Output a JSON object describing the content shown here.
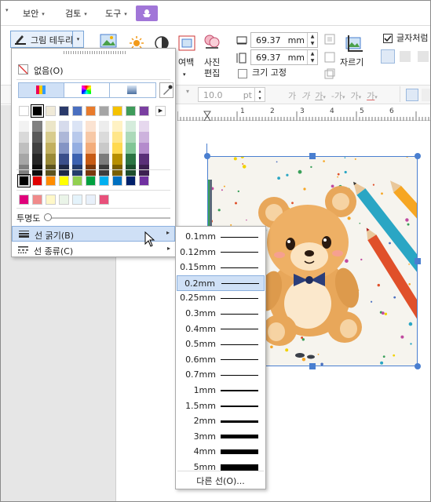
{
  "menubar": {
    "items": [
      {
        "label": "보안"
      },
      {
        "label": "검토"
      },
      {
        "label": "도구"
      }
    ]
  },
  "ribbon": {
    "border_button_label": "그림 테두리",
    "margin_label": "여백",
    "photo_edit_label_1": "사진",
    "photo_edit_label_2": "편집",
    "width_value": "69.37",
    "height_value": "69.37",
    "unit": "mm",
    "fix_size_label": "크기 고정",
    "crop_label": "자르기",
    "wrap_label": "글자처럼"
  },
  "fontrow": {
    "size_value": "10.0",
    "size_unit": "pt"
  },
  "ruler": {
    "numbers": [
      "1",
      "2",
      "3",
      "4",
      "5",
      "6"
    ]
  },
  "border_panel": {
    "none_label": "없음(O)",
    "transparency_label": "투명도",
    "line_width_label": "선 굵기(B)",
    "line_type_label": "선 종류(C)",
    "palette_top_row": [
      "#ffffff",
      "#000000",
      "#f0ead8",
      "#2a3a6a",
      "#4a6fc0",
      "#e87b2c",
      "#a5a5a5",
      "#f5c200",
      "#3e9b5a",
      "#7a3fa0"
    ],
    "palette_columns": [
      [
        "#f2f2f2",
        "#d9d9d9",
        "#bfbfbf",
        "#a6a6a6",
        "#7f7f7f"
      ],
      [
        "#808080",
        "#595959",
        "#404040",
        "#262626",
        "#0d0d0d"
      ],
      [
        "#ece6c8",
        "#d8cc8e",
        "#c2b060",
        "#9a8a38",
        "#5c531f"
      ],
      [
        "#d6dbec",
        "#adb7d8",
        "#8494c4",
        "#3a4e8a",
        "#1e2846"
      ],
      [
        "#dbe4f5",
        "#b8c9eb",
        "#94aee1",
        "#3c62b0",
        "#243c6b"
      ],
      [
        "#fbe3d2",
        "#f7c8a6",
        "#f3ac7a",
        "#c75b15",
        "#7a380c"
      ],
      [
        "#ededed",
        "#dbdbdb",
        "#c9c9c9",
        "#7c7c7c",
        "#3d3d3d"
      ],
      [
        "#fff2c4",
        "#ffe68a",
        "#ffd94f",
        "#b78f00",
        "#7a5f00"
      ],
      [
        "#d5ecdc",
        "#acd9b9",
        "#82c696",
        "#2c7443",
        "#1d4d2c"
      ],
      [
        "#e6d8ee",
        "#cdb2dd",
        "#b48bcc",
        "#5a2f78",
        "#3c1f50"
      ]
    ],
    "palette_standard": [
      "#000000",
      "#e00000",
      "#ff8c00",
      "#ffff00",
      "#92d050",
      "#00a040",
      "#00b0f0",
      "#0070c0",
      "#00206a",
      "#7030a0"
    ],
    "palette_recent": [
      "#e0007a",
      "#f08a8a",
      "#fff8c8",
      "#eaf4e8",
      "#e4f3fb",
      "#e8f0fa",
      "#e8507a"
    ]
  },
  "line_width_menu": {
    "items": [
      {
        "label": "0.1mm",
        "weight": 0.1
      },
      {
        "label": "0.12mm",
        "weight": 0.12
      },
      {
        "label": "0.15mm",
        "weight": 0.15
      },
      {
        "label": "0.2mm",
        "weight": 0.2
      },
      {
        "label": "0.25mm",
        "weight": 0.25
      },
      {
        "label": "0.3mm",
        "weight": 0.3
      },
      {
        "label": "0.4mm",
        "weight": 0.4
      },
      {
        "label": "0.5mm",
        "weight": 0.5
      },
      {
        "label": "0.6mm",
        "weight": 0.6
      },
      {
        "label": "0.7mm",
        "weight": 0.7
      },
      {
        "label": "1mm",
        "weight": 1
      },
      {
        "label": "1.5mm",
        "weight": 1.5
      },
      {
        "label": "2mm",
        "weight": 2
      },
      {
        "label": "3mm",
        "weight": 3
      },
      {
        "label": "4mm",
        "weight": 4
      },
      {
        "label": "5mm",
        "weight": 5
      }
    ],
    "selected": "0.2mm",
    "other_label": "다른 선(O)..."
  }
}
